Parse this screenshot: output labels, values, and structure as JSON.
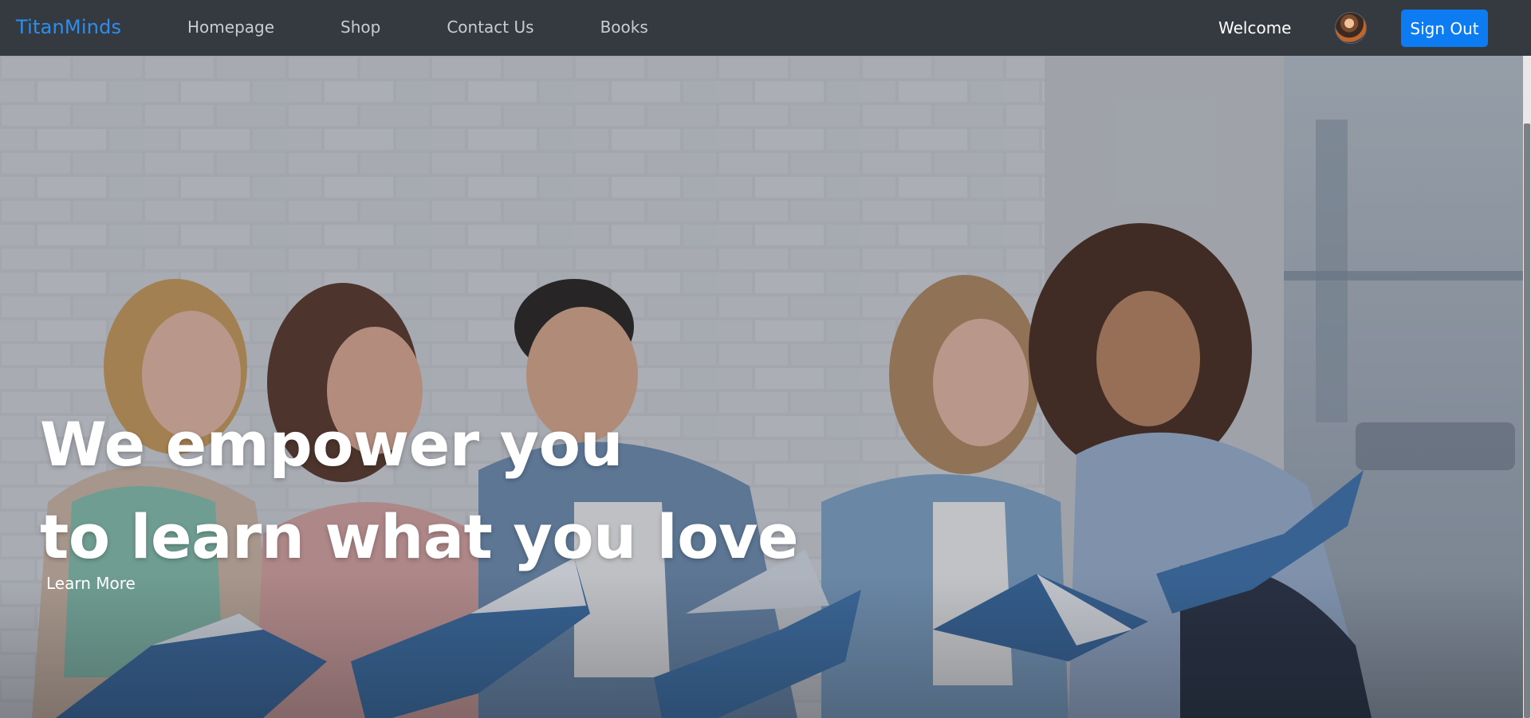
{
  "brand": "TitanMinds",
  "nav": {
    "links": [
      "Homepage",
      "Shop",
      "Contact Us",
      "Books"
    ]
  },
  "user": {
    "welcome": "Welcome",
    "avatar_icon": "user-avatar",
    "sign_out": "Sign Out"
  },
  "hero": {
    "headline_line1_a": "We ",
    "headline_line1_b": "empower",
    "headline_line1_c": " you",
    "headline_line2": "to learn what you love",
    "cta": "Learn More",
    "image": "students-reading-books-photo"
  },
  "colors": {
    "navbar_bg": "#343a40",
    "brand": "#2c8ff0",
    "signout_bg": "#0d7cf2"
  }
}
